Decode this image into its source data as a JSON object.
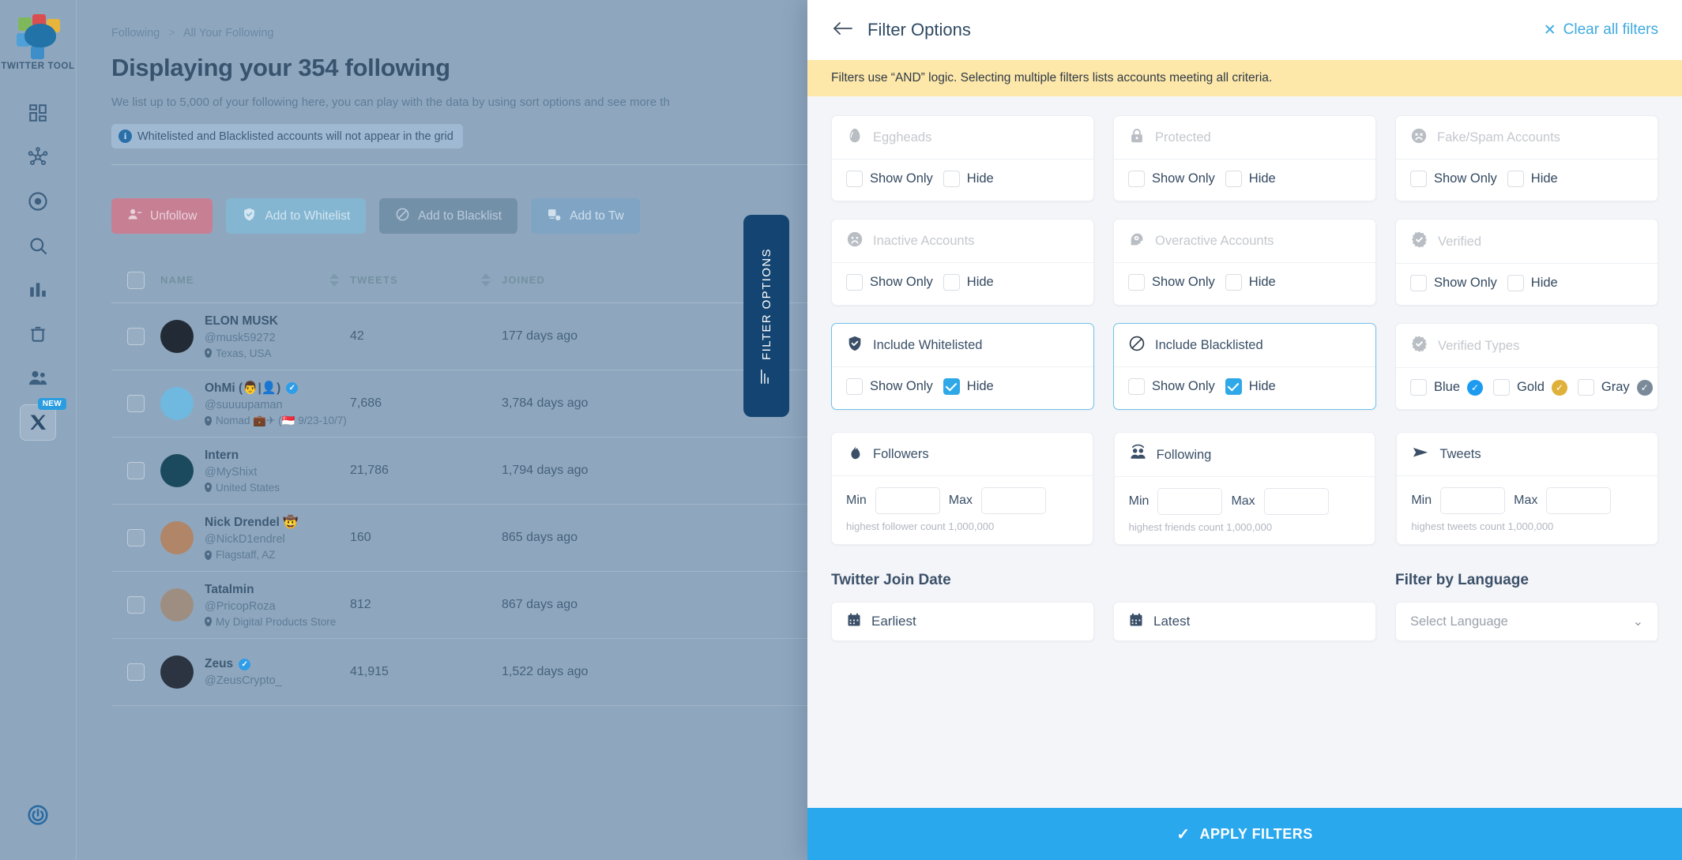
{
  "sidebar": {
    "brand": "TWITTER TOOL",
    "items": [
      {
        "name": "dashboard",
        "icon": "dashboard-icon"
      },
      {
        "name": "network",
        "icon": "network-icon"
      },
      {
        "name": "target",
        "icon": "target-icon"
      },
      {
        "name": "search",
        "icon": "search-icon"
      },
      {
        "name": "analytics",
        "icon": "bar-chart-icon"
      },
      {
        "name": "trash",
        "icon": "trash-icon"
      },
      {
        "name": "people",
        "icon": "people-icon"
      },
      {
        "name": "x-platform",
        "icon": "x-logo-icon",
        "badge": "NEW"
      }
    ],
    "power": "power-icon"
  },
  "main": {
    "breadcrumb": {
      "first": "Following",
      "separator": ">",
      "second": "All Your Following"
    },
    "title": "Displaying your 354 following",
    "subtitle": "We list up to 5,000 of your following here, you can play with the data by using sort options and see more th",
    "notice": "Whitelisted and Blacklisted accounts will not appear in the grid",
    "notice_icon": "info-icon",
    "actions": [
      {
        "label": "Unfollow",
        "icon": "user-minus-icon"
      },
      {
        "label": "Add to Whitelist",
        "icon": "shield-check-icon"
      },
      {
        "label": "Add to Blacklist",
        "icon": "ban-icon"
      },
      {
        "label": "Add to Tw",
        "icon": "list-add-icon"
      }
    ],
    "table": {
      "columns": [
        "NAME",
        "TWEETS",
        "JOINED"
      ],
      "rows": [
        {
          "name": "ELON MUSK",
          "handle": "@musk59272",
          "location": "Texas, USA",
          "verified": false,
          "tweets": "42",
          "joined": "177 days ago"
        },
        {
          "name": "OhMi (👨|👤)",
          "handle": "@suuuupaman",
          "location": "Nomad 💼✈ (🇸🇬 9/23-10/7)",
          "verified": true,
          "tweets": "7,686",
          "joined": "3,784 days ago"
        },
        {
          "name": "Intern",
          "handle": "@MyShixt",
          "location": "United States",
          "verified": false,
          "tweets": "21,786",
          "joined": "1,794 days ago"
        },
        {
          "name": "Nick Drendel 🤠",
          "handle": "@NickD1endrel",
          "location": "Flagstaff, AZ",
          "verified": false,
          "tweets": "160",
          "joined": "865 days ago"
        },
        {
          "name": "Tatalmin",
          "handle": "@PricopRoza",
          "location": "My Digital Products Store",
          "verified": false,
          "tweets": "812",
          "joined": "867 days ago"
        },
        {
          "name": "Zeus",
          "handle": "@ZeusCrypto_",
          "location": "",
          "verified": true,
          "tweets": "41,915",
          "joined": "1,522 days ago"
        }
      ]
    }
  },
  "filter_tab": {
    "label": "FILTER OPTIONS",
    "icon": "sliders-icon"
  },
  "panel": {
    "back_icon": "arrow-left-icon",
    "title": "Filter Options",
    "clear_all": "Clear all filters",
    "clear_icon": "close-x-icon",
    "notice": "Filters use “AND” logic. Selecting multiple filters lists accounts meeting all criteria.",
    "toggle_cards": [
      {
        "title": "Eggheads",
        "icon": "egg-icon",
        "active": false,
        "show_only": "Show Only",
        "hide": "Hide",
        "show_only_checked": false,
        "hide_checked": false
      },
      {
        "title": "Protected",
        "icon": "lock-icon",
        "active": false,
        "show_only": "Show Only",
        "hide": "Hide",
        "show_only_checked": false,
        "hide_checked": false
      },
      {
        "title": "Fake/Spam Accounts",
        "icon": "sad-face-icon",
        "active": false,
        "show_only": "Show Only",
        "hide": "Hide",
        "show_only_checked": false,
        "hide_checked": false
      },
      {
        "title": "Inactive Accounts",
        "icon": "frown-face-icon",
        "active": false,
        "show_only": "Show Only",
        "hide": "Hide",
        "show_only_checked": false,
        "hide_checked": false
      },
      {
        "title": "Overactive Accounts",
        "icon": "head-gear-icon",
        "active": false,
        "show_only": "Show Only",
        "hide": "Hide",
        "show_only_checked": false,
        "hide_checked": false
      },
      {
        "title": "Verified",
        "icon": "verified-badge-icon",
        "active": false,
        "show_only": "Show Only",
        "hide": "Hide",
        "show_only_checked": false,
        "hide_checked": false
      },
      {
        "title": "Include Whitelisted",
        "icon": "shield-check-icon",
        "active": true,
        "show_only": "Show Only",
        "hide": "Hide",
        "show_only_checked": false,
        "hide_checked": true
      },
      {
        "title": "Include Blacklisted",
        "icon": "ban-icon",
        "active": true,
        "show_only": "Show Only",
        "hide": "Hide",
        "show_only_checked": false,
        "hide_checked": true
      }
    ],
    "verified_types": {
      "title": "Verified Types",
      "icon": "verified-badge-icon",
      "options": [
        {
          "label": "Blue",
          "checked": false,
          "color": "#1d9bf0"
        },
        {
          "label": "Gold",
          "checked": false,
          "color": "#e0b13a"
        },
        {
          "label": "Gray",
          "checked": false,
          "color": "#7a8a99"
        }
      ]
    },
    "ranges": [
      {
        "title": "Followers",
        "icon": "flame-icon",
        "min_label": "Min",
        "max_label": "Max",
        "min_value": "",
        "max_value": "",
        "hint": "highest follower count 1,000,000"
      },
      {
        "title": "Following",
        "icon": "people-icon",
        "min_label": "Min",
        "max_label": "Max",
        "min_value": "",
        "max_value": "",
        "hint": "highest friends count 1,000,000"
      },
      {
        "title": "Tweets",
        "icon": "send-icon",
        "min_label": "Min",
        "max_label": "Max",
        "min_value": "",
        "max_value": "",
        "hint": "highest tweets count 1,000,000"
      }
    ],
    "join_date": {
      "section_label": "Twitter Join Date",
      "earliest": "Earliest",
      "latest": "Latest",
      "calendar_icon": "calendar-icon"
    },
    "language": {
      "section_label": "Filter by Language",
      "placeholder": "Select Language",
      "chevron": "chevron-down-icon"
    },
    "apply": {
      "label": "APPLY FILTERS",
      "icon": "check-icon"
    }
  }
}
